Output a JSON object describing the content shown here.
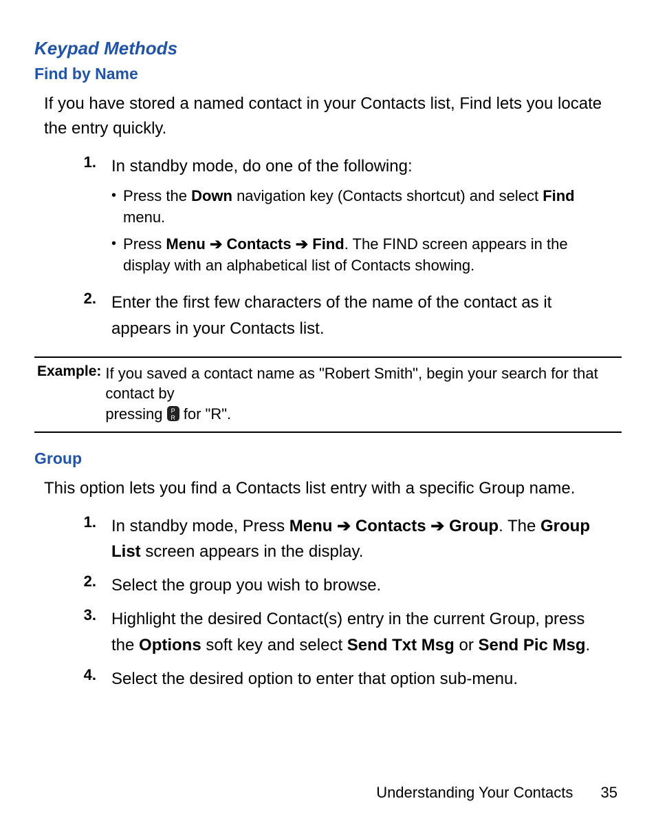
{
  "section": {
    "title": "Keypad Methods"
  },
  "find": {
    "title": "Find by Name",
    "intro": "If you have stored a named contact in your Contacts list, Find lets you locate the entry quickly.",
    "step1": {
      "num": "1.",
      "text": "In standby mode, do one of the following:",
      "bullets": {
        "b1": {
          "pre": "Press the ",
          "bold1": "Down",
          "post": " navigation key (Contacts shortcut) and select ",
          "bold2": "Find",
          "tail": " menu."
        },
        "b2": {
          "pre": "Press ",
          "bold1": "Menu",
          "arrow1": " ➔ ",
          "bold2": "Contacts",
          "arrow2": " ➔ ",
          "bold3": "Find",
          "post": ". The FIND screen appears in the display with an alphabetical list of Contacts showing."
        }
      }
    },
    "step2": {
      "num": "2.",
      "text": "Enter the first few characters of the name of the contact as it appears in your Contacts list."
    }
  },
  "example": {
    "label": "Example:",
    "line1": "If you saved a contact name as \"Robert Smith\", begin your search for that contact by",
    "line2a": "pressing ",
    "keytop": "P",
    "keybot": "R",
    "line2b": " for \"R\"."
  },
  "group": {
    "title": "Group",
    "intro": "This option lets you find a Contacts list entry with a specific Group name.",
    "step1": {
      "num": "1.",
      "pre": "In standby mode, Press ",
      "bold1": "Menu",
      "arrow1": " ➔ ",
      "bold2": "Contacts",
      "arrow2": " ➔ ",
      "bold3": "Group",
      "mid": ". The ",
      "bold4": "Group List",
      "post": " screen appears in the display."
    },
    "step2": {
      "num": "2.",
      "text": "Select the group you wish to browse."
    },
    "step3": {
      "num": "3.",
      "pre": "Highlight the desired Contact(s) entry in the current Group, press the ",
      "bold1": "Options",
      "mid": " soft key and select ",
      "bold2": "Send Txt Msg",
      "or": " or ",
      "bold3": "Send Pic Msg",
      "post": "."
    },
    "step4": {
      "num": "4.",
      "text": "Select the desired option to enter that option sub-menu."
    }
  },
  "footer": {
    "chapter": "Understanding Your Contacts",
    "page": "35"
  }
}
